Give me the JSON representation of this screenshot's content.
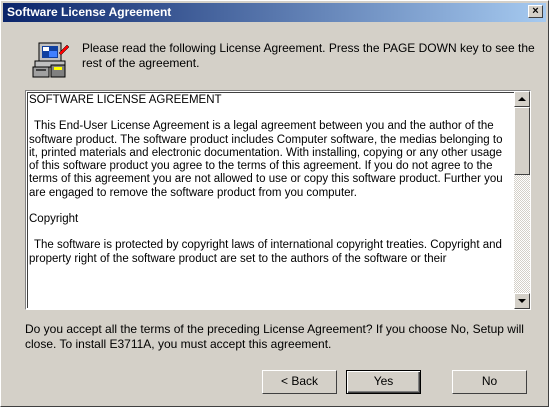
{
  "window": {
    "title": "Software License Agreement",
    "close_label": "×"
  },
  "instructions": "Please read the following License Agreement.  Press the PAGE DOWN key to see the rest of the agreement.",
  "license": {
    "heading": "SOFTWARE LICENSE AGREEMENT",
    "paragraph1": "This End-User License Agreement is a legal agreement between you and the author of the software product. The software product includes Computer software, the medias belonging to it, printed materials and electronic documentation. With installing, copying or any other usage of this software product you agree to the terms of this agreement. If you do not agree to the terms of this agreement you are not allowed to use or copy this software product. Further you are engaged to remove the software product from you computer.",
    "copyright_heading": "Copyright",
    "paragraph2": "The software is protected by copyright laws of international copyright treaties. Copyright and property right of the software product are set to the authors of the software or their"
  },
  "question": "Do you accept all the terms of the preceding License Agreement?  If you choose No,  Setup will close.  To install E3711A, you must accept this agreement.",
  "buttons": {
    "back": "< Back",
    "yes": "Yes",
    "no": "No"
  },
  "icons": {
    "header": "setup-computer-icon",
    "close": "close-icon",
    "scroll_up": "scroll-up-arrow-icon",
    "scroll_down": "scroll-down-arrow-icon"
  },
  "colors": {
    "titlebar_start": "#0a246a",
    "titlebar_end": "#a6caf0",
    "dialog_face": "#d4d0c8"
  }
}
